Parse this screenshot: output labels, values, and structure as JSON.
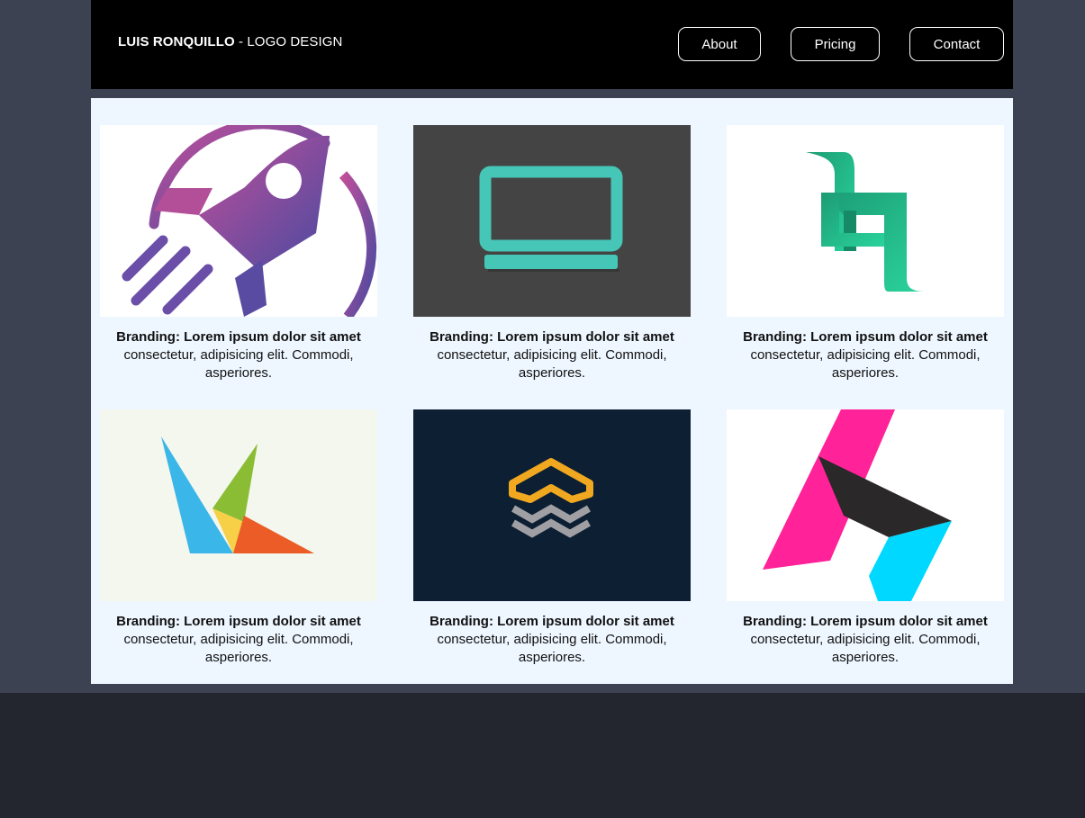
{
  "header": {
    "brand_name": "LUIS RONQUILLO",
    "brand_suffix": " - LOGO DESIGN",
    "nav": [
      {
        "label": "About"
      },
      {
        "label": "Pricing"
      },
      {
        "label": "Contact"
      }
    ]
  },
  "colors": {
    "page_bg": "#3c4252",
    "footer_bg": "#23262f",
    "header_bg": "#000000",
    "content_bg": "#eef6ff"
  },
  "portfolio": [
    {
      "logo": "rocket-logo",
      "title": "Branding: Lorem ipsum dolor sit amet",
      "desc": "consectetur, adipisicing elit. Commodi, asperiores."
    },
    {
      "logo": "laptop-logo",
      "title": "Branding: Lorem ipsum dolor sit amet",
      "desc": "consectetur, adipisicing elit. Commodi, asperiores."
    },
    {
      "logo": "green-q-logo",
      "title": "Branding: Lorem ipsum dolor sit amet",
      "desc": "consectetur, adipisicing elit. Commodi, asperiores."
    },
    {
      "logo": "bird-k-logo",
      "title": "Branding: Lorem ipsum dolor sit amet",
      "desc": "consectetur, adipisicing elit. Commodi, asperiores."
    },
    {
      "logo": "layers-logo",
      "title": "Branding: Lorem ipsum dolor sit amet",
      "desc": "consectetur, adipisicing elit. Commodi, asperiores."
    },
    {
      "logo": "pink-h-logo",
      "title": "Branding: Lorem ipsum dolor sit amet",
      "desc": "consectetur, adipisicing elit. Commodi, asperiores."
    }
  ]
}
